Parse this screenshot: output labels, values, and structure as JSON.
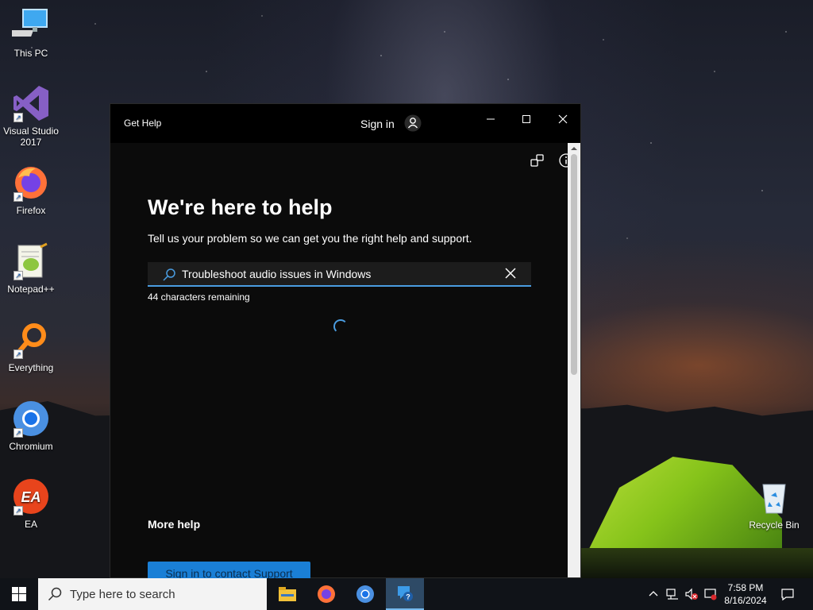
{
  "desktop": {
    "icons": [
      {
        "label": "This PC",
        "icon": "computer-icon"
      },
      {
        "label": "Visual Studio 2017",
        "icon": "visual-studio-icon"
      },
      {
        "label": "Firefox",
        "icon": "firefox-icon"
      },
      {
        "label": "Notepad++",
        "icon": "notepadpp-icon"
      },
      {
        "label": "Everything",
        "icon": "search-magnifier-icon"
      },
      {
        "label": "Chromium",
        "icon": "chromium-icon"
      },
      {
        "label": "EA",
        "icon": "ea-icon"
      },
      {
        "label": "Recycle Bin",
        "icon": "recycle-bin-icon"
      }
    ]
  },
  "window": {
    "title": "Get Help",
    "sign_in_label": "Sign in",
    "headline": "We're here to help",
    "subline": "Tell us your problem so we can get you the right help and support.",
    "search": {
      "value": "Troubleshoot audio issues in Windows",
      "chars_remaining": "44 characters remaining"
    },
    "more_help_heading": "More help",
    "contact_button": "Sign in to contact Support",
    "accent": "#4a9ce0",
    "button_color": "#1a7fd6"
  },
  "taskbar": {
    "search_placeholder": "Type here to search",
    "pinned": [
      "file-explorer-icon",
      "firefox-icon",
      "chromium-icon",
      "get-help-icon"
    ],
    "active_app": "get-help-icon",
    "time": "7:58 PM",
    "date": "8/16/2024"
  }
}
